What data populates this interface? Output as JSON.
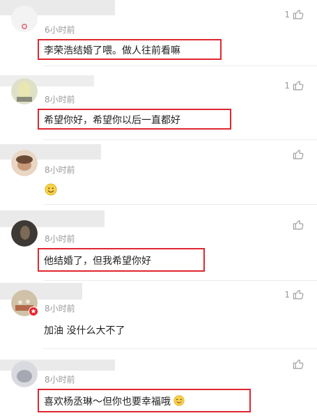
{
  "comments": [
    {
      "time": "6小时前",
      "text": "李荣浩结婚了喂。做人往前看嘛",
      "likes": "1",
      "highlighted": true
    },
    {
      "time": "8小时前",
      "text": "希望你好，希望你以后一直都好",
      "likes": "1",
      "highlighted": true
    },
    {
      "time": "8小时前",
      "text": "",
      "likes": "",
      "highlighted": false
    },
    {
      "time": "8小时前",
      "text": "他结婚了，但我希望你好",
      "likes": "",
      "highlighted": true
    },
    {
      "time": "8小时前",
      "text": "加油 没什么大不了",
      "likes": "1",
      "highlighted": false
    },
    {
      "time": "8小时前",
      "text": "喜欢杨丞琳～但你也要幸福哦",
      "likes": "",
      "highlighted": true
    }
  ],
  "icons": {
    "like": "thumbs-up-icon",
    "emoji_smile": "smile-emoji-icon",
    "emoji_blush": "blush-emoji-icon"
  },
  "colors": {
    "highlight": "#e0262f",
    "time": "#9a9a9a",
    "text": "#222222"
  }
}
